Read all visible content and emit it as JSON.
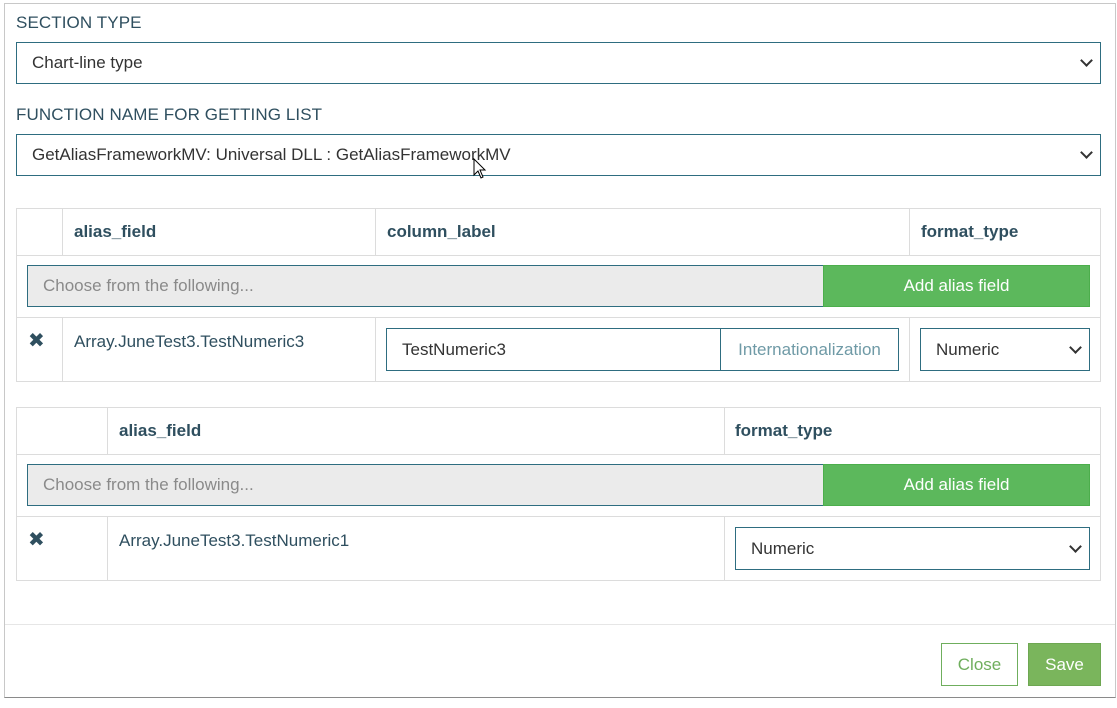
{
  "section_type": {
    "label": "SECTION TYPE",
    "value": "Chart-line type"
  },
  "function_name": {
    "label": "FUNCTION NAME FOR GETTING LIST",
    "value": "GetAliasFrameworkMV: Universal DLL : GetAliasFrameworkMV"
  },
  "table1": {
    "headers": [
      "alias_field",
      "column_label",
      "format_type"
    ],
    "chooser_placeholder": "Choose from the following...",
    "add_label": "Add alias field",
    "rows": [
      {
        "alias_field": "Array.JuneTest3.TestNumeric3",
        "column_label": "TestNumeric3",
        "internationalization_label": "Internationalization",
        "format_type": "Numeric"
      }
    ]
  },
  "table2": {
    "headers": [
      "alias_field",
      "format_type"
    ],
    "chooser_placeholder": "Choose from the following...",
    "add_label": "Add alias field",
    "rows": [
      {
        "alias_field": "Array.JuneTest3.TestNumeric1",
        "format_type": "Numeric"
      }
    ]
  },
  "footer": {
    "close_label": "Close",
    "save_label": "Save"
  },
  "colors": {
    "accent_teal": "#2e6d80",
    "add_green": "#5cb85c",
    "save_green": "#7ab55c"
  },
  "icons": {
    "remove": "close-icon",
    "dropdown": "chevron-down-icon"
  }
}
